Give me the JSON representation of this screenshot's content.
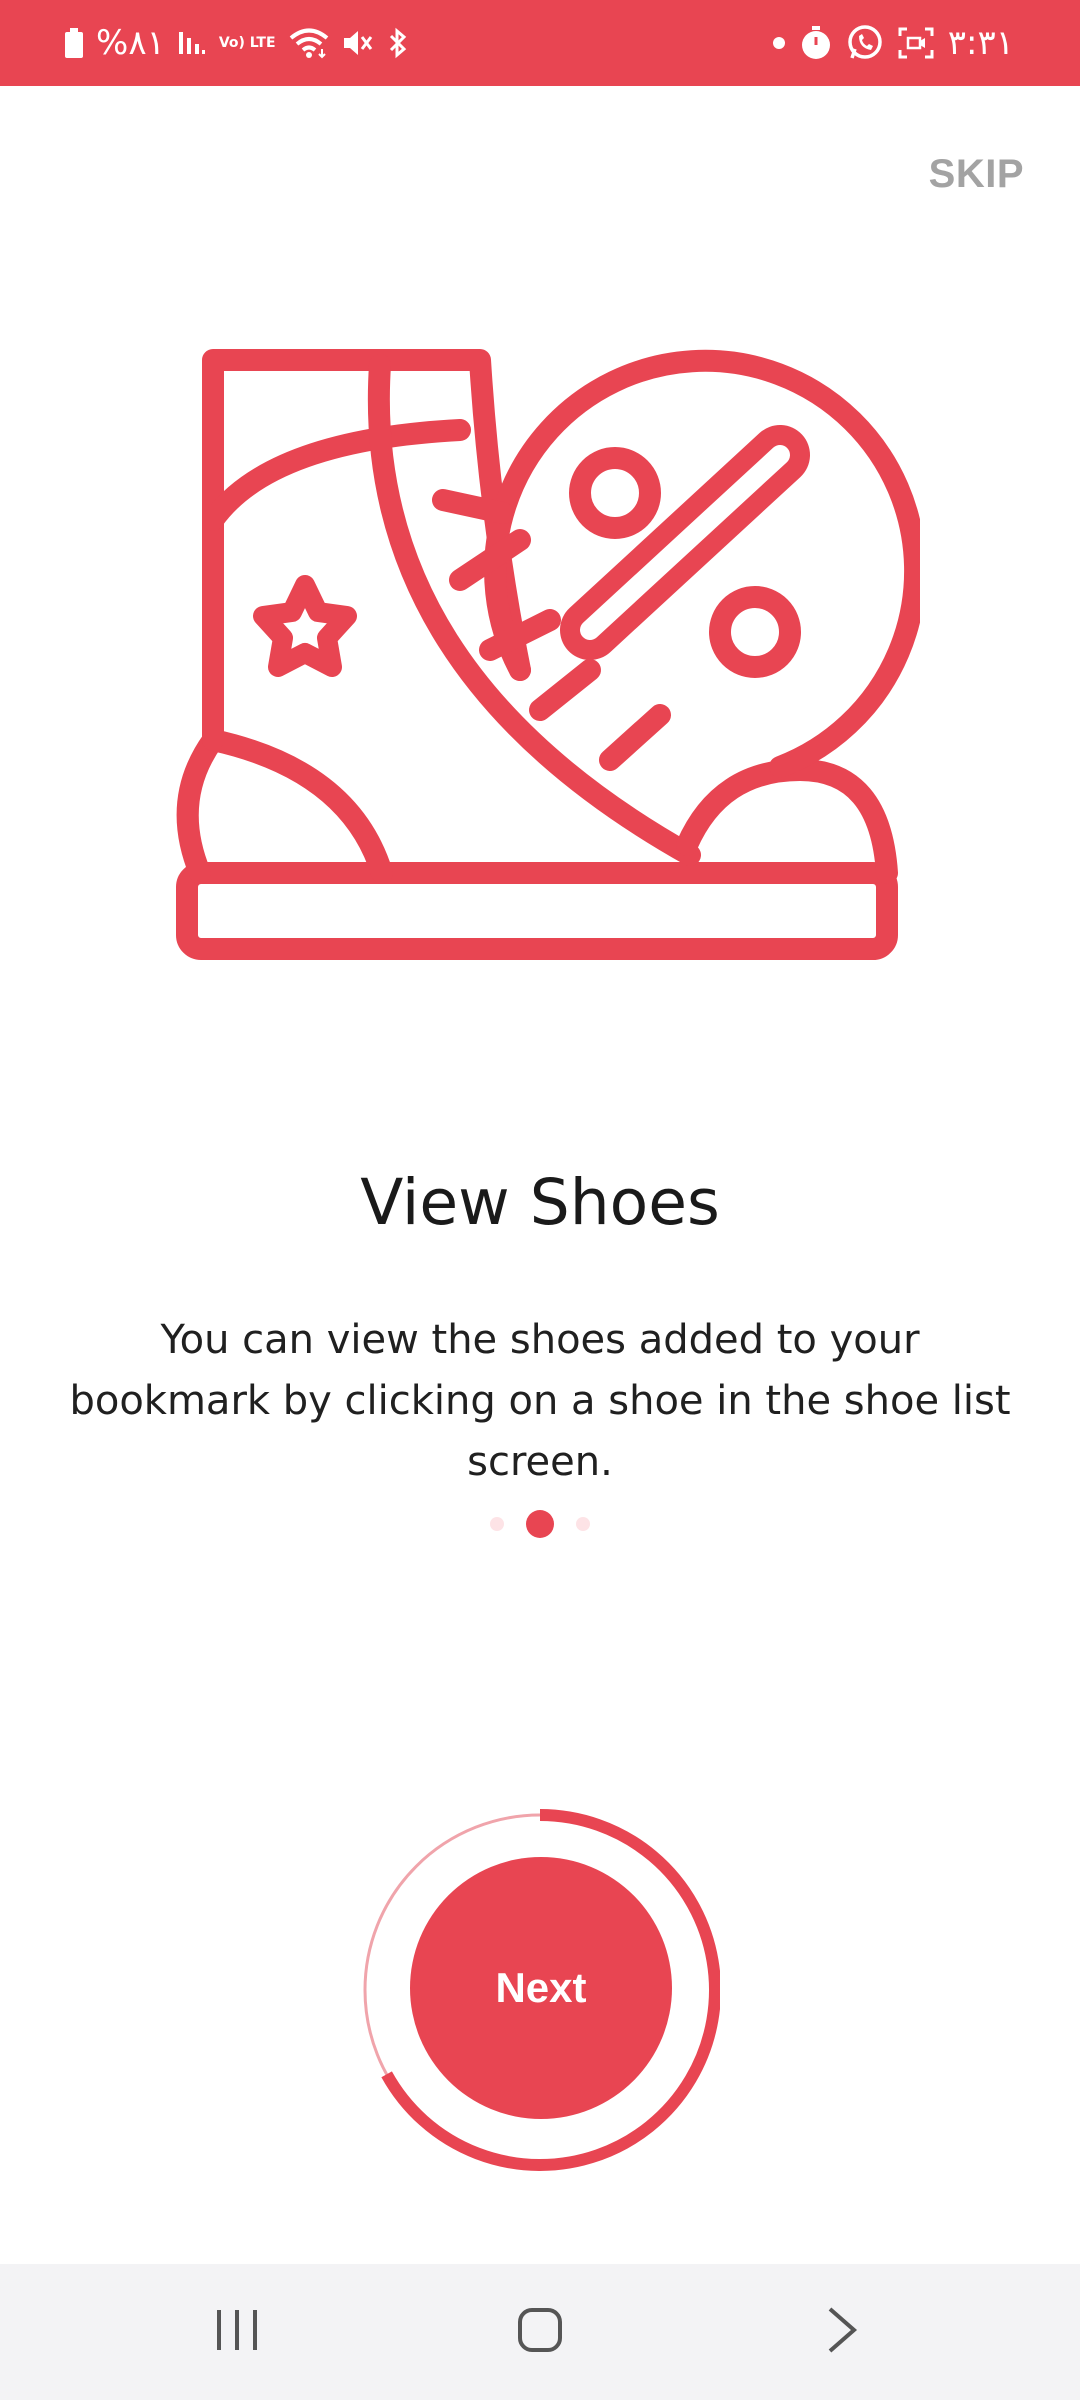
{
  "status_bar": {
    "battery_percent": "%٨١",
    "network_type": "Vo) LTE",
    "time": "٣:٣١",
    "icons": [
      "battery-icon",
      "signal-icon",
      "lte-icon",
      "wifi-icon",
      "mute-icon",
      "bluetooth-icon",
      "dot-icon",
      "timer-icon",
      "whatsapp-icon",
      "screen-record-icon"
    ]
  },
  "onboarding": {
    "skip_label": "SKIP",
    "illustration_icon": "shoe-discount-icon",
    "title": "View Shoes",
    "description": "You can view the shoes added to your bookmark by clicking on a shoe in the shoe list screen.",
    "pages": 3,
    "current_page": 2,
    "next_label": "Next",
    "progress_fraction": 0.67
  },
  "nav_bar": {
    "buttons": [
      "recents-icon",
      "home-icon",
      "back-icon"
    ]
  },
  "colors": {
    "accent": "#e84552",
    "skip_text": "#a3a3a3",
    "title_text": "#1a1a1a",
    "nav_background": "#f3f3f5"
  }
}
